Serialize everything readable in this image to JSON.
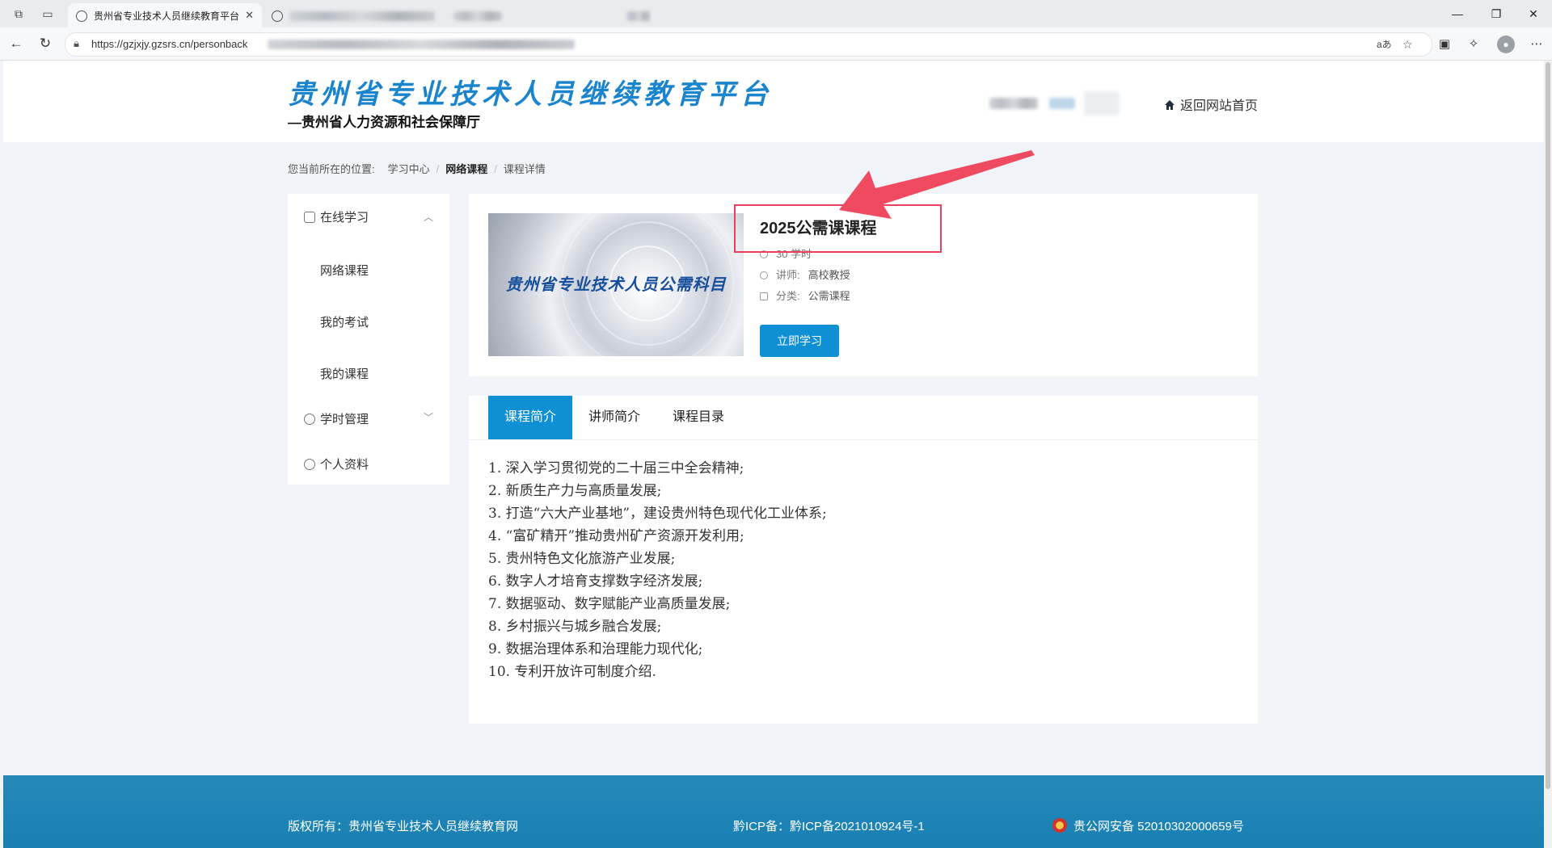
{
  "browser": {
    "tab_title": "贵州省专业技术人员继续教育平台",
    "url": "https://gzjxjy.gzsrs.cn/personback",
    "tab_close": "✕",
    "reader_label": "aあ"
  },
  "header": {
    "site_title": "贵州省专业技术人员继续教育平台",
    "subtitle": "—贵州省人力资源和社会保障厅",
    "home_link": "返回网站首页"
  },
  "breadcrumb": {
    "prefix": "您当前所在的位置:",
    "items": [
      "学习中心",
      "网络课程",
      "课程详情"
    ]
  },
  "sidebar": {
    "online_study": "在线学习",
    "sub_items": [
      "网络课程",
      "我的考试",
      "我的课程"
    ],
    "hours_mgmt": "学时管理",
    "profile": "个人资料"
  },
  "course": {
    "title": "2025公需课课程",
    "hours": "30 学时",
    "teacher_label": "讲师:",
    "teacher": "高校教授",
    "category_label": "分类:",
    "category": "公需课程",
    "thumbnail_caption": "贵州省专业技术人员公需科目",
    "study_button": "立即学习"
  },
  "tabs": [
    "课程简介",
    "讲师简介",
    "课程目录"
  ],
  "intro": [
    "1. 深入学习贯彻党的二十届三中全会精神;",
    "2. 新质生产力与高质量发展;",
    "3. 打造“六大产业基地”，建设贵州特色现代化工业体系;",
    "4. “富矿精开”推动贵州矿产资源开发利用;",
    "5. 贵州特色文化旅游产业发展;",
    "6. 数字人才培育支撑数字经济发展;",
    "7. 数据驱动、数字赋能产业高质量发展;",
    "8. 乡村振兴与城乡融合发展;",
    "9. 数据治理体系和治理能力现代化;",
    "10. 专利开放许可制度介绍."
  ],
  "footer": {
    "copyright": "版权所有：贵州省专业技术人员继续教育网",
    "icp": "黔ICP备：黔ICP备2021010924号-1",
    "police": "贵公网安备 52010302000659号"
  },
  "colors": {
    "accent": "#0f8fd4",
    "highlight": "#ef3f5b",
    "footer": "#1f84b5"
  }
}
